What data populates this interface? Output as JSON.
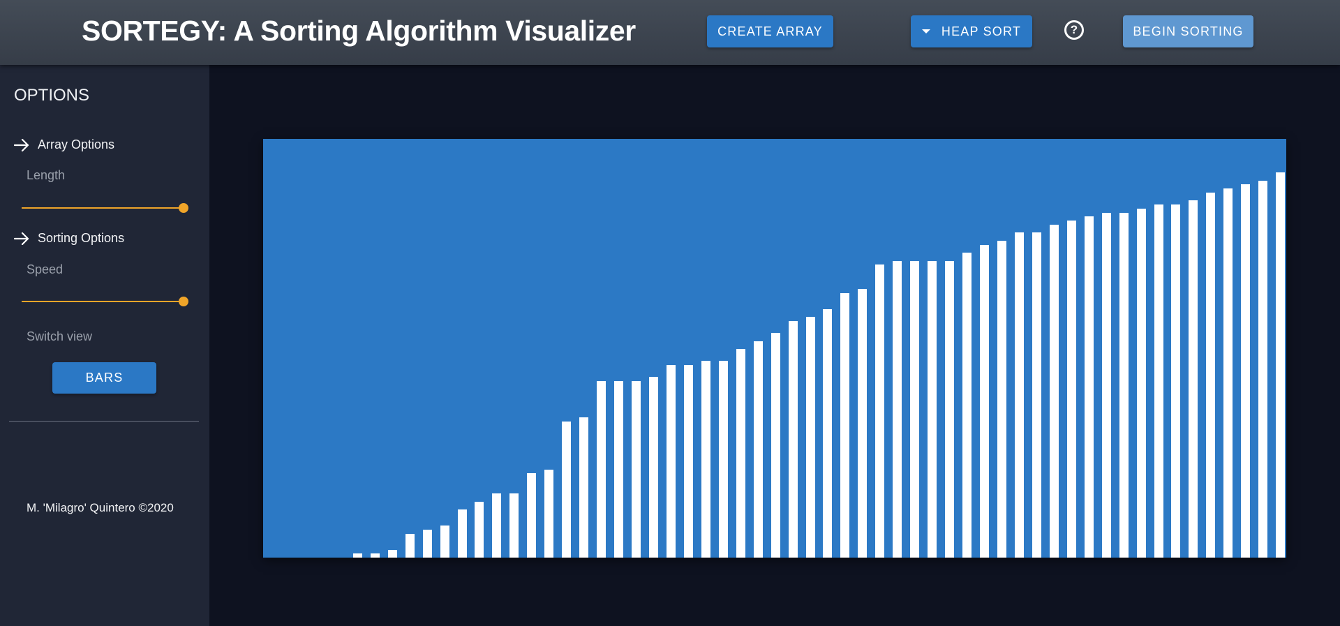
{
  "header": {
    "title": "SORTEGY: A Sorting Algorithm Visualizer",
    "create_array_label": "CREATE ARRAY",
    "algorithm_label": "HEAP SORT",
    "help_glyph": "?",
    "begin_label": "BEGIN SORTING"
  },
  "sidebar": {
    "title": "OPTIONS",
    "array_options_label": "Array Options",
    "length_label": "Length",
    "length_value_fraction": 1.0,
    "sorting_options_label": "Sorting Options",
    "speed_label": "Speed",
    "speed_value_fraction": 1.0,
    "switch_view_label": "Switch view",
    "view_button_label": "BARS",
    "footer": "M. 'Milagro' Quintero ©2020"
  },
  "colors": {
    "accent": "#f0a529",
    "button": "#2b78c5",
    "canvas": "#2c79c5",
    "bar": "#ffffff"
  },
  "icons": {
    "section_icon": "arrow-right-icon",
    "help_icon": "help-circle-icon",
    "dropdown_icon": "caret-down-icon"
  },
  "chart_data": {
    "type": "bar",
    "values": [
      0,
      0,
      0,
      0,
      1,
      1,
      2,
      6,
      7,
      8,
      12,
      14,
      16,
      16,
      21,
      22,
      34,
      35,
      44,
      44,
      44,
      45,
      48,
      48,
      49,
      49,
      52,
      54,
      56,
      59,
      60,
      62,
      66,
      67,
      73,
      74,
      74,
      74,
      74,
      76,
      78,
      79,
      81,
      81,
      83,
      84,
      85,
      86,
      86,
      87,
      88,
      88,
      89,
      91,
      92,
      93,
      94,
      96
    ]
  }
}
